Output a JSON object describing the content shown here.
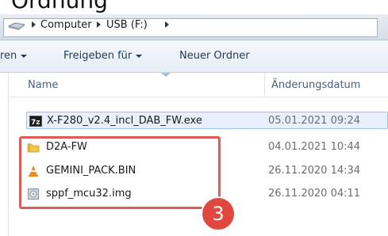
{
  "heading_partial": "Ordnung",
  "address": {
    "crumbs": [
      "Computer",
      "USB (F:)"
    ]
  },
  "toolbar": {
    "organize_partial": "ren",
    "share_label": "Freigeben für",
    "new_folder_label": "Neuer Ordner"
  },
  "columns": {
    "name": "Name",
    "date": "Änderungsdatum"
  },
  "files": [
    {
      "name": "X-F280_v2.4_incl_DAB_FW.exe",
      "date": "05.01.2021 09:24",
      "icon": "7zip-exe-icon",
      "selected": true
    },
    {
      "name": "D2A-FW",
      "date": "04.01.2021 10:44",
      "icon": "folder-icon",
      "selected": false
    },
    {
      "name": "GEMINI_PACK.BIN",
      "date": "26.11.2020 14:34",
      "icon": "vlc-cone-icon",
      "selected": false
    },
    {
      "name": "sppf_mcu32.img",
      "date": "26.11.2020 04:11",
      "icon": "disk-image-icon",
      "selected": false
    }
  ],
  "annotation": {
    "step_number": "3",
    "highlight_color": "#e05a5a",
    "badge_color": "#e0473f"
  }
}
